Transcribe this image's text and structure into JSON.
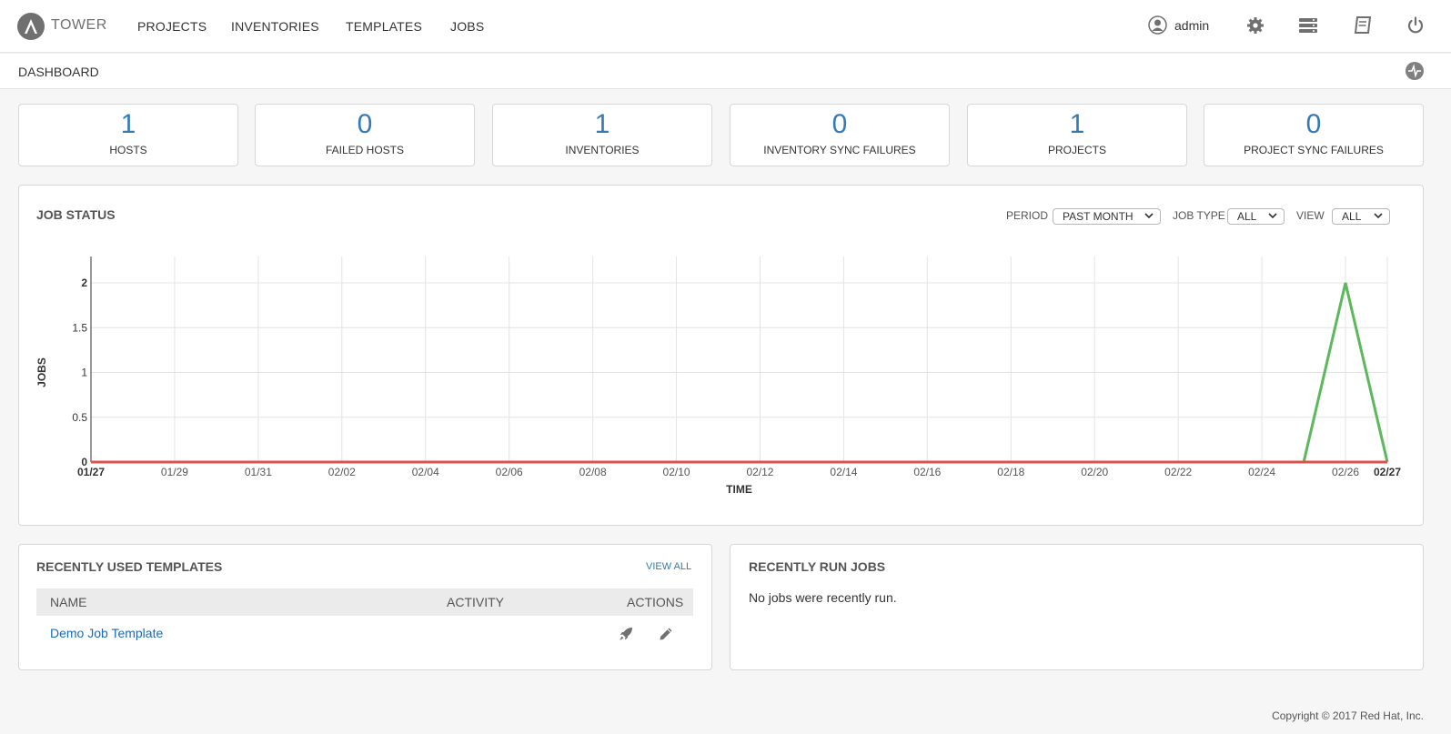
{
  "nav": {
    "brand": "TOWER",
    "links": [
      "PROJECTS",
      "INVENTORIES",
      "TEMPLATES",
      "JOBS"
    ],
    "user": "admin",
    "icons": [
      "user-icon",
      "gear-icon",
      "server-icon",
      "book-icon",
      "power-icon"
    ]
  },
  "breadcrumb": {
    "label": "DASHBOARD"
  },
  "counts": [
    {
      "value": "1",
      "label": "HOSTS"
    },
    {
      "value": "0",
      "label": "FAILED HOSTS"
    },
    {
      "value": "1",
      "label": "INVENTORIES"
    },
    {
      "value": "0",
      "label": "INVENTORY SYNC FAILURES"
    },
    {
      "value": "1",
      "label": "PROJECTS"
    },
    {
      "value": "0",
      "label": "PROJECT SYNC FAILURES"
    }
  ],
  "job_status": {
    "title": "JOB STATUS",
    "period_label": "PERIOD",
    "period_value": "PAST MONTH",
    "job_type_label": "JOB TYPE",
    "job_type_value": "ALL",
    "view_label": "VIEW",
    "view_value": "ALL"
  },
  "chart_data": {
    "type": "line",
    "title": "",
    "xlabel": "TIME",
    "ylabel": "JOBS",
    "x": [
      "01/27",
      "01/28",
      "01/29",
      "01/30",
      "01/31",
      "02/01",
      "02/02",
      "02/03",
      "02/04",
      "02/05",
      "02/06",
      "02/07",
      "02/08",
      "02/09",
      "02/10",
      "02/11",
      "02/12",
      "02/13",
      "02/14",
      "02/15",
      "02/16",
      "02/17",
      "02/18",
      "02/19",
      "02/20",
      "02/21",
      "02/22",
      "02/23",
      "02/24",
      "02/25",
      "02/26",
      "02/27"
    ],
    "x_ticks": [
      "01/27",
      "01/29",
      "01/31",
      "02/02",
      "02/04",
      "02/06",
      "02/08",
      "02/10",
      "02/12",
      "02/14",
      "02/16",
      "02/18",
      "02/20",
      "02/22",
      "02/24",
      "02/26",
      "02/27"
    ],
    "y_ticks": [
      "0",
      "0.5",
      "1",
      "1.5",
      "2"
    ],
    "ylim": [
      0,
      2
    ],
    "grid": true,
    "series": [
      {
        "color": "#5cb85c",
        "values": [
          0,
          0,
          0,
          0,
          0,
          0,
          0,
          0,
          0,
          0,
          0,
          0,
          0,
          0,
          0,
          0,
          0,
          0,
          0,
          0,
          0,
          0,
          0,
          0,
          0,
          0,
          0,
          0,
          0,
          0,
          2,
          0
        ]
      },
      {
        "color": "#d9534f",
        "values": [
          0,
          0,
          0,
          0,
          0,
          0,
          0,
          0,
          0,
          0,
          0,
          0,
          0,
          0,
          0,
          0,
          0,
          0,
          0,
          0,
          0,
          0,
          0,
          0,
          0,
          0,
          0,
          0,
          0,
          0,
          0,
          0
        ]
      }
    ]
  },
  "templates": {
    "title": "RECENTLY USED TEMPLATES",
    "view_all": "VIEW ALL",
    "columns": [
      "NAME",
      "ACTIVITY",
      "ACTIONS"
    ],
    "rows": [
      {
        "name": "Demo Job Template"
      }
    ]
  },
  "recent_jobs": {
    "title": "RECENTLY RUN JOBS",
    "empty": "No jobs were recently run."
  },
  "footer": {
    "copyright": "Copyright © 2017 Red Hat, Inc."
  }
}
